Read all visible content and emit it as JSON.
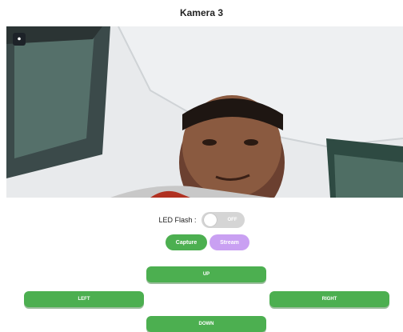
{
  "page": {
    "title": "Kamera 3"
  },
  "camera": {
    "toggle_icon": "camera-switch-icon"
  },
  "flash": {
    "label": "LED Flash :",
    "state": "OFF"
  },
  "buttons": {
    "capture": "Capture",
    "stream": "Stream",
    "up": "UP",
    "left": "LEFT",
    "right": "RIGHT",
    "down": "DOWN"
  },
  "colors": {
    "green": "#4caf50",
    "purple": "#c9a0f2",
    "switch_off": "#d5d5d5"
  }
}
